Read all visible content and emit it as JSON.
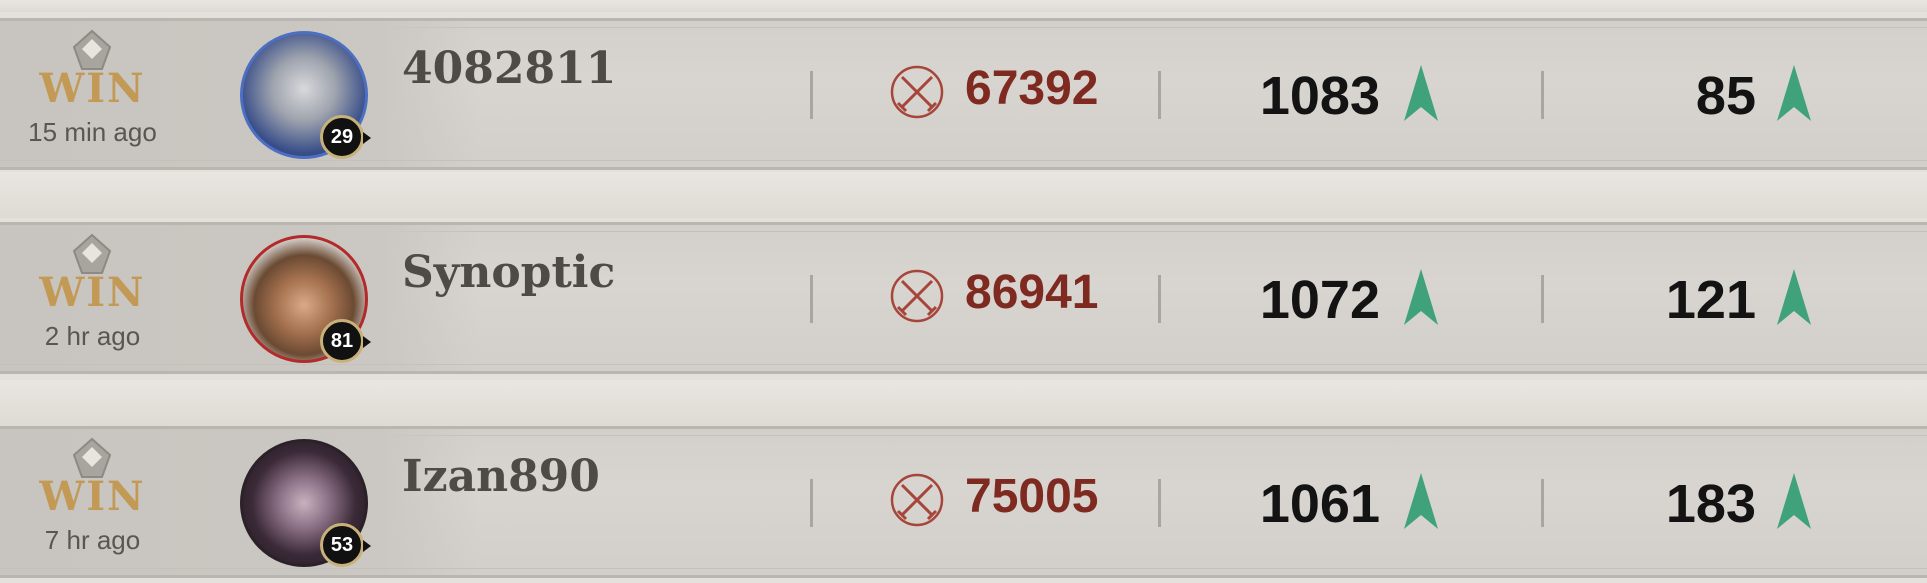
{
  "matches": [
    {
      "result": "WIN",
      "time": "15 min ago",
      "level": "29",
      "name": "4082811",
      "score": "67392",
      "rating": "1083",
      "rank": "85"
    },
    {
      "result": "WIN",
      "time": "2 hr ago",
      "level": "81",
      "name": "Synoptic",
      "score": "86941",
      "rating": "1072",
      "rank": "121"
    },
    {
      "result": "WIN",
      "time": "7 hr ago",
      "level": "53",
      "name": "Izan890",
      "score": "75005",
      "rating": "1061",
      "rank": "183"
    }
  ],
  "colors": {
    "win_gold": "#c39a55",
    "score_red": "#7f2a20",
    "arrow_green": "#3fa27a"
  },
  "icons": {
    "result": "shield-emblem-icon",
    "score": "crossed-swords-icon",
    "trend": "up-arrow-icon"
  }
}
